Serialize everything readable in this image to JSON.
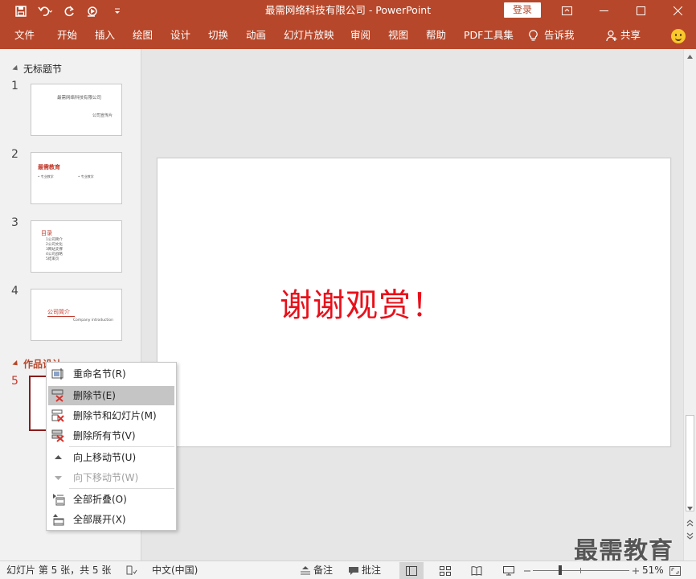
{
  "window": {
    "title": "最需网络科技有限公司  -  PowerPoint",
    "login_label": "登录"
  },
  "ribbon": {
    "tabs": [
      "文件",
      "开始",
      "插入",
      "绘图",
      "设计",
      "切换",
      "动画",
      "幻灯片放映",
      "审阅",
      "视图",
      "帮助",
      "PDF工具集",
      "告诉我",
      "共享"
    ]
  },
  "thumbs": {
    "section1": "无标题节",
    "section2": "作品设计",
    "numbers": [
      "1",
      "2",
      "3",
      "4",
      "5"
    ],
    "slide1": {
      "title": "最需网络科技有限公司",
      "subtitle": "公司宣传片"
    },
    "slide2": {
      "title": "最需教育",
      "item1": "• 专业教学",
      "item2": "• 专业教学"
    },
    "slide3": {
      "title": "目录",
      "items": [
        "1公司简介",
        "2公司文化",
        "3网站支撑",
        "4公司战略",
        "5结束页"
      ]
    },
    "slide4": {
      "title": "公司简介",
      "subtitle": "Company introduction"
    }
  },
  "slide": {
    "main_text": "谢谢观赏！"
  },
  "context_menu": {
    "items": [
      {
        "label": "重命名节(R)",
        "enabled": true
      },
      {
        "label": "删除节(E)",
        "enabled": true,
        "highlighted": true
      },
      {
        "label": "删除节和幻灯片(M)",
        "enabled": true
      },
      {
        "label": "删除所有节(V)",
        "enabled": true
      },
      {
        "label": "向上移动节(U)",
        "enabled": true
      },
      {
        "label": "向下移动节(W)",
        "enabled": false
      },
      {
        "label": "全部折叠(O)",
        "enabled": true
      },
      {
        "label": "全部展开(X)",
        "enabled": true
      }
    ]
  },
  "statusbar": {
    "slide_info": "幻灯片 第 5 张，共 5 张",
    "language": "中文(中国)",
    "notes": "备注",
    "comments": "批注",
    "zoom": "51%",
    "zoom_level": 0.51
  },
  "watermark": "最需教育",
  "colors": {
    "accent": "#b7472a",
    "slide_text": "#e8101a",
    "menu_hover": "#c5c5c5"
  }
}
